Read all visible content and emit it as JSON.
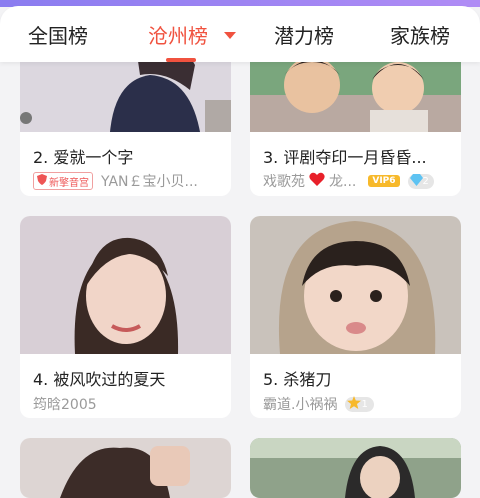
{
  "tabs": [
    {
      "label": "全国榜",
      "active": false
    },
    {
      "label": "沧州榜",
      "active": true
    },
    {
      "label": "潜力榜",
      "active": false
    },
    {
      "label": "家族榜",
      "active": false
    }
  ],
  "colors": {
    "accent": "#f0523f",
    "vip": "#f7b92b"
  },
  "cards": [
    {
      "title": "2. 爱就一个字",
      "badge": "新擎音宫",
      "user": "YAN￡宝小贝..."
    },
    {
      "title": "3. 评剧夺印一月昏昏...",
      "user": "戏歌苑",
      "user_suffix": "龙...",
      "vip": "VIP6",
      "diamonds": "2"
    },
    {
      "title": "4. 被风吹过的夏天",
      "user": "筠晗2005"
    },
    {
      "title": "5. 杀猪刀",
      "user": "霸道.小祸祸",
      "stars": "1"
    }
  ]
}
